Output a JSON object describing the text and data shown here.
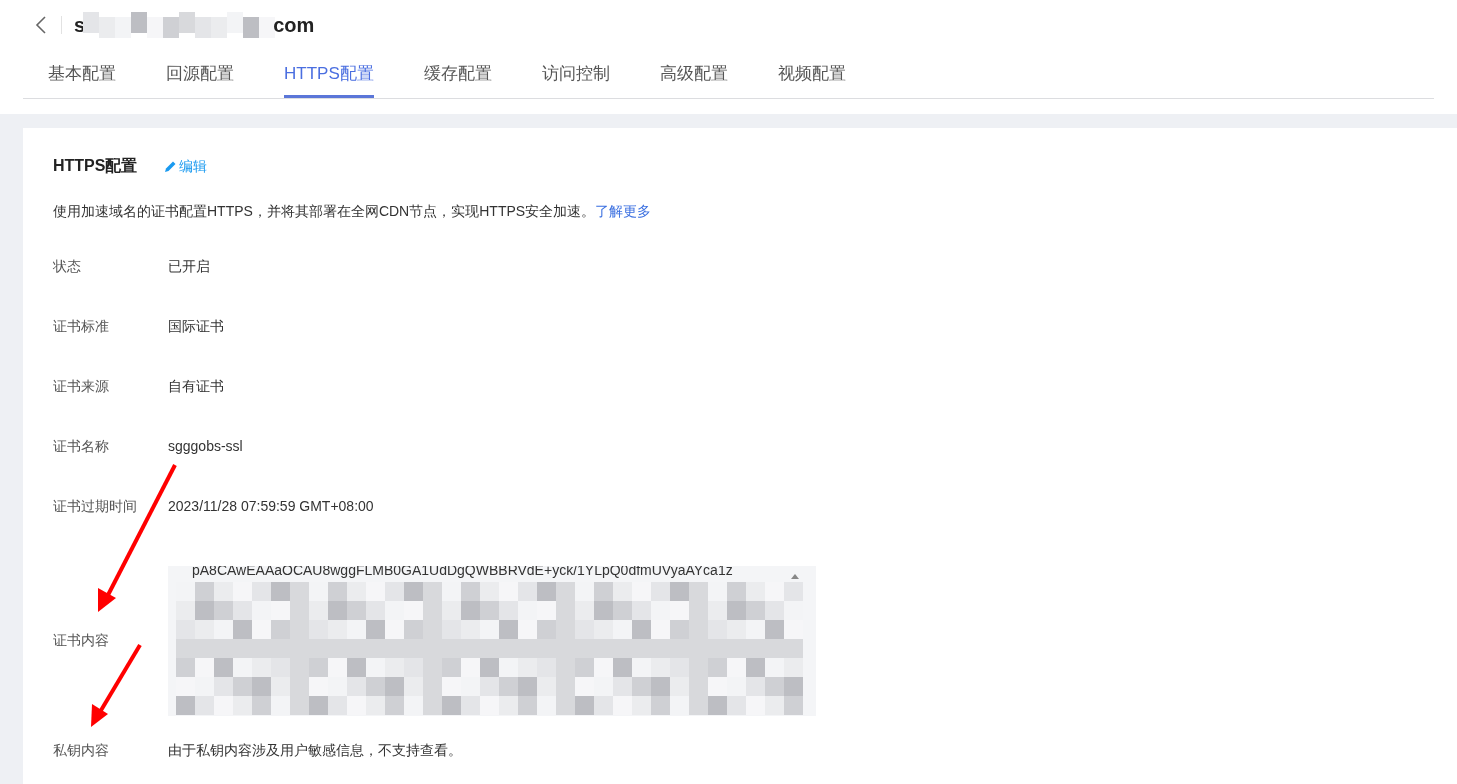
{
  "header": {
    "title_start": "s",
    "title_end": "com"
  },
  "tabs": [
    {
      "label": "基本配置",
      "selected": false
    },
    {
      "label": "回源配置",
      "selected": false
    },
    {
      "label": "HTTPS配置",
      "selected": true
    },
    {
      "label": "缓存配置",
      "selected": false
    },
    {
      "label": "访问控制",
      "selected": false
    },
    {
      "label": "高级配置",
      "selected": false
    },
    {
      "label": "视频配置",
      "selected": false
    }
  ],
  "section": {
    "title": "HTTPS配置",
    "edit_link": "编辑",
    "description": "使用加速域名的证书配置HTTPS，并将其部署在全网CDN节点，实现HTTPS安全加速。",
    "learn_more": "了解更多"
  },
  "fields": [
    {
      "kind": "text",
      "label": "状态",
      "value": "已开启"
    },
    {
      "kind": "text",
      "label": "证书标准",
      "value": "国际证书"
    },
    {
      "kind": "text",
      "label": "证书来源",
      "value": "自有证书"
    },
    {
      "kind": "text",
      "label": "证书名称",
      "value": "sgggobs-ssl"
    },
    {
      "kind": "text",
      "label": "证书过期时间",
      "value": "2023/11/28 07:59:59 GMT+08:00"
    },
    {
      "kind": "textarea",
      "label": "证书内容",
      "value": "pA8CAwEAAaOCAU8wggFLMB0GA1UdDgQWBBRVdE+yck/1YLpQ0dfmUVyaAYca1z"
    },
    {
      "kind": "text",
      "label": "私钥内容",
      "value": "由于私钥内容涉及用户敏感信息，不支持查看。"
    }
  ]
}
